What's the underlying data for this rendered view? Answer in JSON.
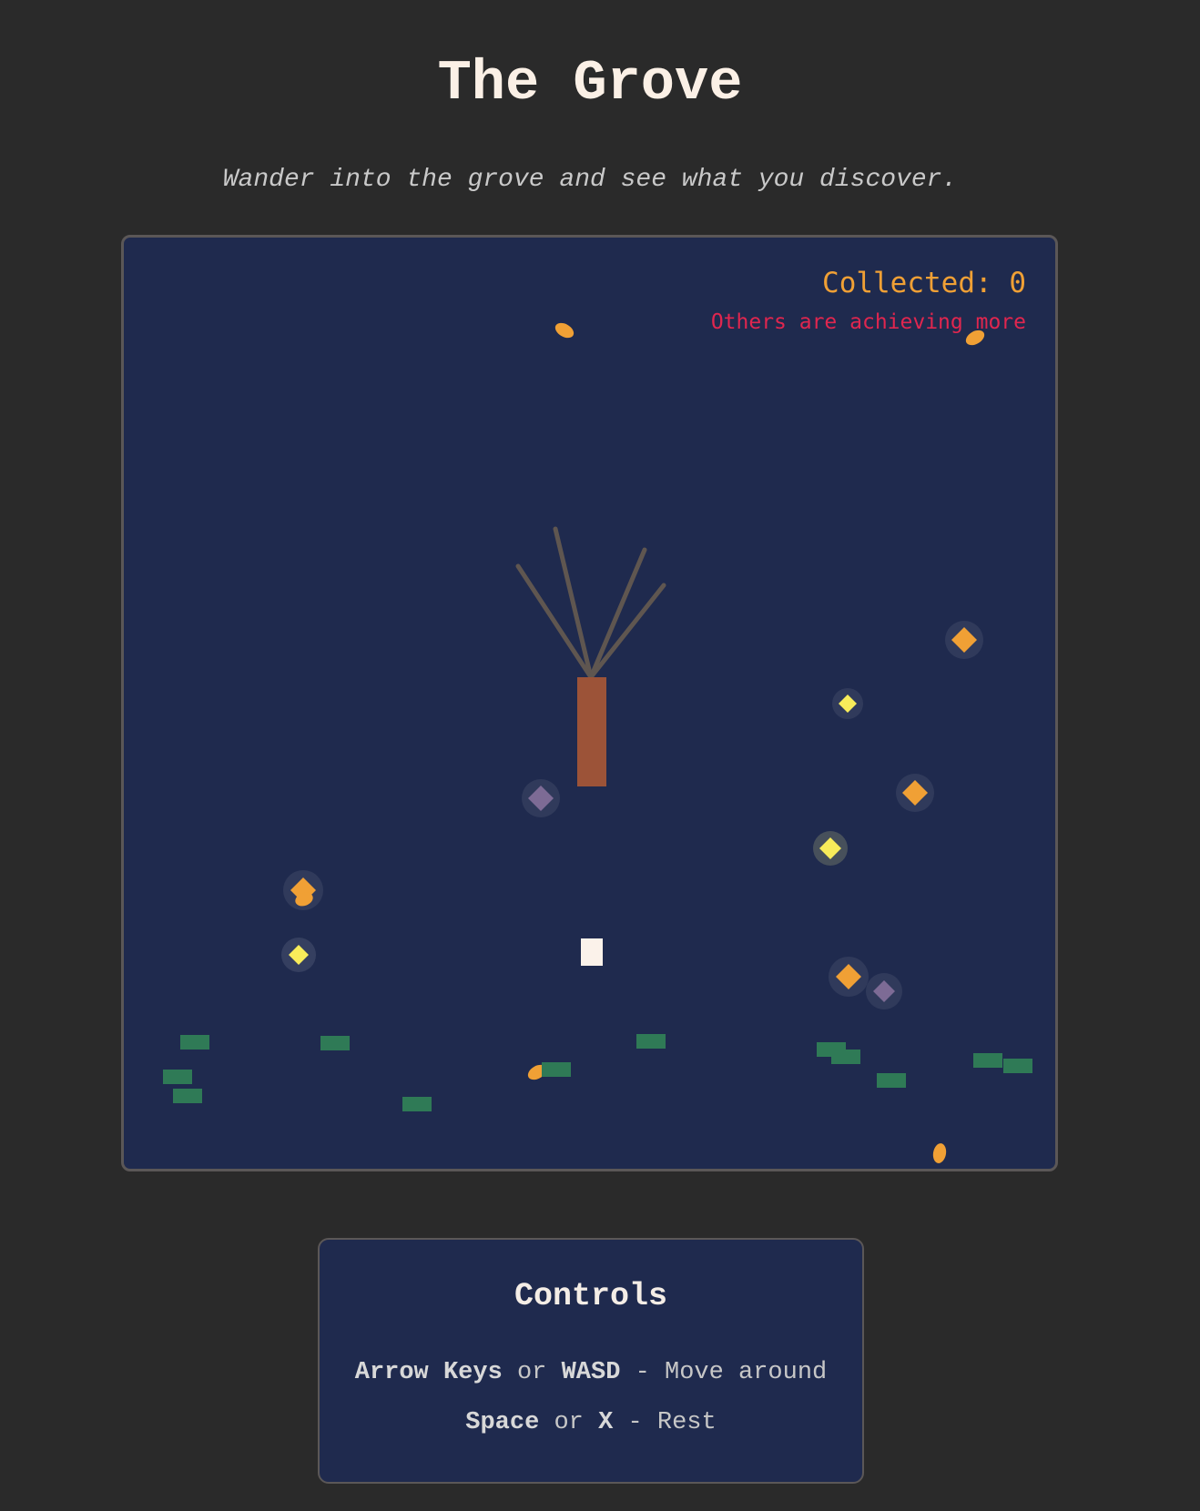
{
  "page": {
    "title": "The Grove",
    "subtitle": "Wander into the grove and see what you discover."
  },
  "hud": {
    "collected_label": "Collected: 0",
    "collected_count": 0,
    "message": "Others are achieving more"
  },
  "controls": {
    "title": "Controls",
    "move_keys_1": "Arrow Keys",
    "move_sep": "or",
    "move_keys_2": "WASD",
    "move_desc": "- Move around",
    "rest_key_1": "Space",
    "rest_sep": "or",
    "rest_key_2": "X",
    "rest_desc": "- Rest"
  },
  "colors": {
    "page_background": "#2a2a2a",
    "game_background": "#1f2a4e",
    "frame_border": "#5b5757",
    "hud_collected": "#f0a035",
    "hud_message": "#e0264f",
    "tree_trunk": "#9c5338",
    "tree_branch": "#5f5650",
    "player": "#fbf2ea",
    "gem_orange": "#f0a035",
    "gem_yellow": "#f8ec5a",
    "gem_purple": "#7d6b95",
    "grass": "#2f7a56",
    "leaf": "#f0a035"
  },
  "icons": {
    "player": "player-square",
    "tree": "bare-tree",
    "gem": "diamond-gem",
    "leaf": "falling-leaf",
    "grass": "grass-tuft"
  }
}
